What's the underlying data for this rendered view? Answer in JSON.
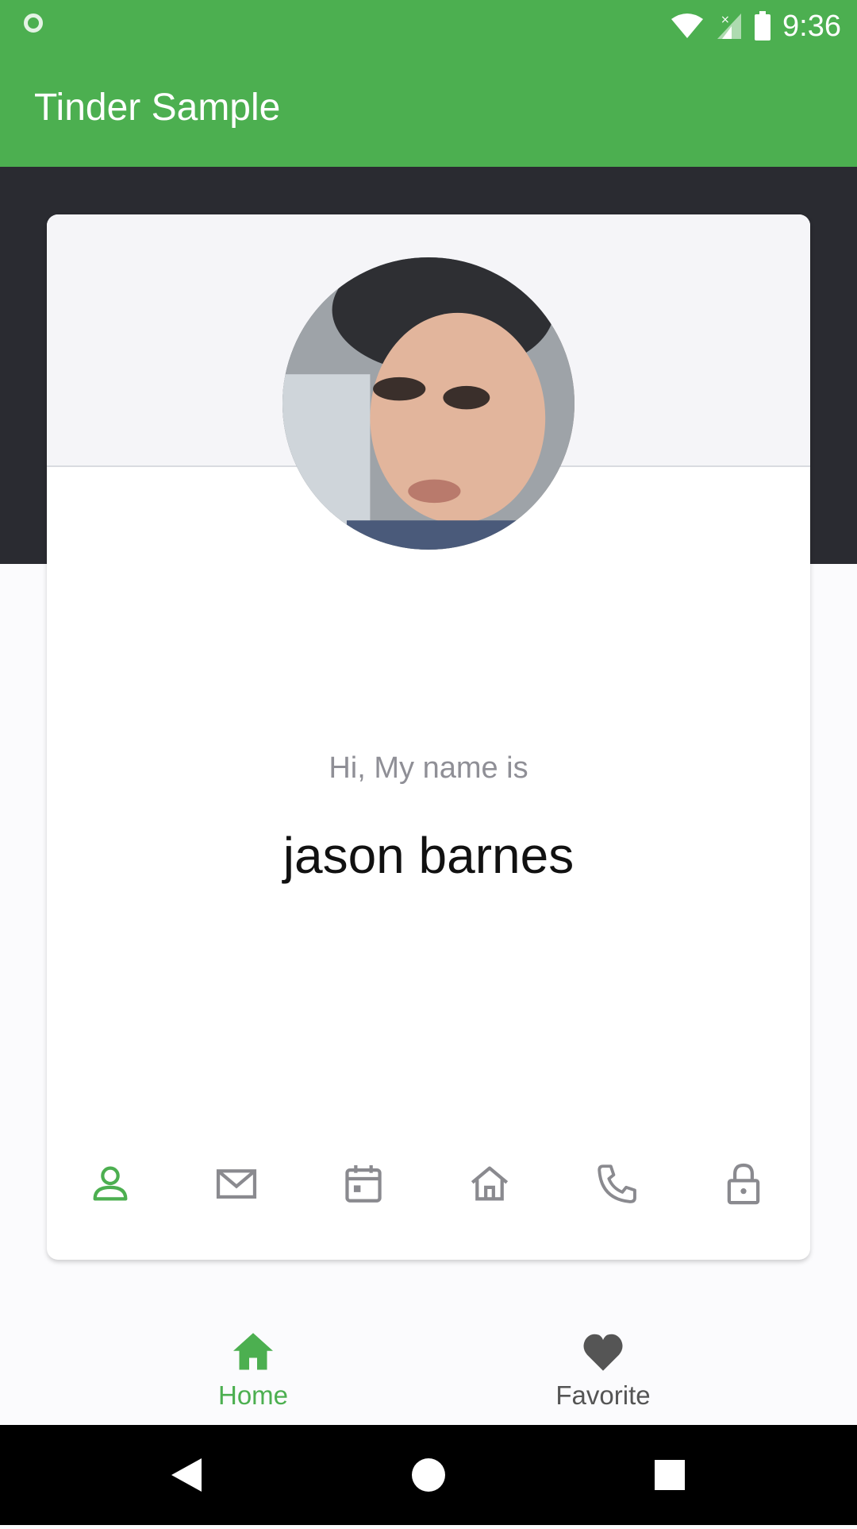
{
  "status_bar": {
    "time": "9:36"
  },
  "app_bar": {
    "title": "Tinder Sample"
  },
  "profile": {
    "greeting": "Hi, My name is",
    "name": "jason barnes"
  },
  "tabs": [
    {
      "icon": "person-icon",
      "active": true
    },
    {
      "icon": "mail-icon",
      "active": false
    },
    {
      "icon": "calendar-icon",
      "active": false
    },
    {
      "icon": "home-outline-icon",
      "active": false
    },
    {
      "icon": "phone-icon",
      "active": false
    },
    {
      "icon": "lock-icon",
      "active": false
    }
  ],
  "bottom_nav": {
    "items": [
      {
        "label": "Home",
        "icon": "home-icon",
        "active": true
      },
      {
        "label": "Favorite",
        "icon": "heart-icon",
        "active": false
      }
    ]
  },
  "colors": {
    "primary": "#4caf50",
    "header_dark": "#2a2b31",
    "inactive_icon": "#8a8a8f"
  }
}
